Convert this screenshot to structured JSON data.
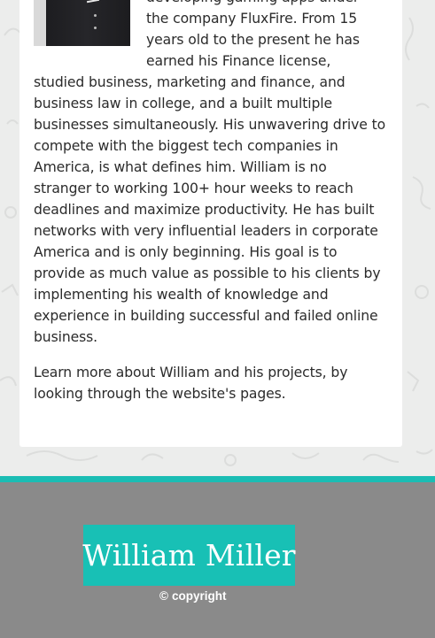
{
  "bio": {
    "lines_right_of_photo": [
      "developing gaming apps under",
      "the company FluxFire. From 15",
      "years old to the present he has",
      "earned his Finance license,"
    ],
    "lines_full_width": [
      "studied business, marketing and finance, and",
      "business law in college, and a built multiple",
      "businesses simultaneously. His unwavering drive to",
      "compete with the biggest tech companies in",
      "America, is what defines him. William is no",
      "stranger to working 100+ hour weeks to reach",
      "deadlines and maximize productivity. He has built",
      "networks with very influential leaders in corporate",
      "America and is only beginning. His goal is to",
      "provide as much value as possible to his clients by",
      "implementing his wealth of knowledge and",
      "experience in building successful and failed online",
      "business."
    ]
  },
  "learn_more": {
    "lines": [
      "Learn more about William and his projects, by",
      "looking through the website's pages."
    ]
  },
  "footer": {
    "logo_text": "William Miller",
    "copyright_symbol": "©",
    "copyright_text": "copyright"
  },
  "colors": {
    "accent": "#1bbdb4",
    "footer_bg": "#8a8a8a",
    "page_bg": "#ecedec"
  },
  "icons": {
    "profile_photo": "portrait-photo"
  }
}
